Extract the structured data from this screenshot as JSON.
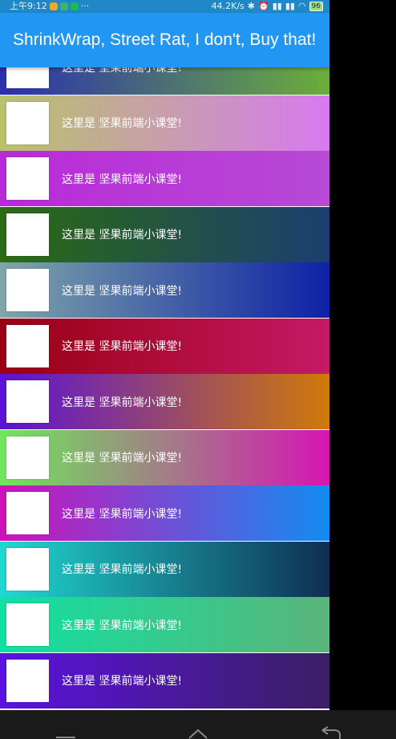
{
  "status_bar": {
    "time": "上午9:12",
    "extra": "···",
    "speed": "44.2K/s",
    "battery": "96",
    "app_badge_colors": [
      "#f5a623",
      "#3cb371",
      "#1db954"
    ]
  },
  "appbar": {
    "title": "ShrinkWrap, Street Rat, I don't, Buy that!",
    "color": "#2196f3"
  },
  "rows": [
    {
      "text": "这里是 坚果前端小课堂!",
      "c1": "#2a2fb0",
      "c2": "#6cae3a"
    },
    {
      "text": "这里是 坚果前端小课堂!",
      "c1": "#b8c26a",
      "c2": "#d77af0"
    },
    {
      "text": "这里是 坚果前端小课堂!",
      "c1": "#b82ad8",
      "c2": "#b74ad6"
    },
    {
      "text": "这里是 坚果前端小课堂!",
      "c1": "#2b6b12",
      "c2": "#1b3f6f"
    },
    {
      "text": "这里是 坚果前端小课堂!",
      "c1": "#7fa6a8",
      "c2": "#0d21a6"
    },
    {
      "text": "这里是 坚果前端小课堂!",
      "c1": "#990012",
      "c2": "#c51965"
    },
    {
      "text": "这里是 坚果前端小课堂!",
      "c1": "#5a12d6",
      "c2": "#d07a08"
    },
    {
      "text": "这里是 坚果前端小课堂!",
      "c1": "#6de85a",
      "c2": "#d615b3"
    },
    {
      "text": "这里是 坚果前端小课堂!",
      "c1": "#cf11b9",
      "c2": "#138cf2"
    },
    {
      "text": "这里是 坚果前端小课堂!",
      "c1": "#20d8d2",
      "c2": "#0f2f52"
    },
    {
      "text": "这里是 坚果前端小课堂!",
      "c1": "#10e0a2",
      "c2": "#5ab57a"
    },
    {
      "text": "这里是 坚果前端小课堂!",
      "c1": "#5b12e0",
      "c2": "#3b1f63"
    }
  ],
  "navbar": {
    "buttons": [
      "recents-icon",
      "home-icon",
      "back-icon"
    ]
  }
}
